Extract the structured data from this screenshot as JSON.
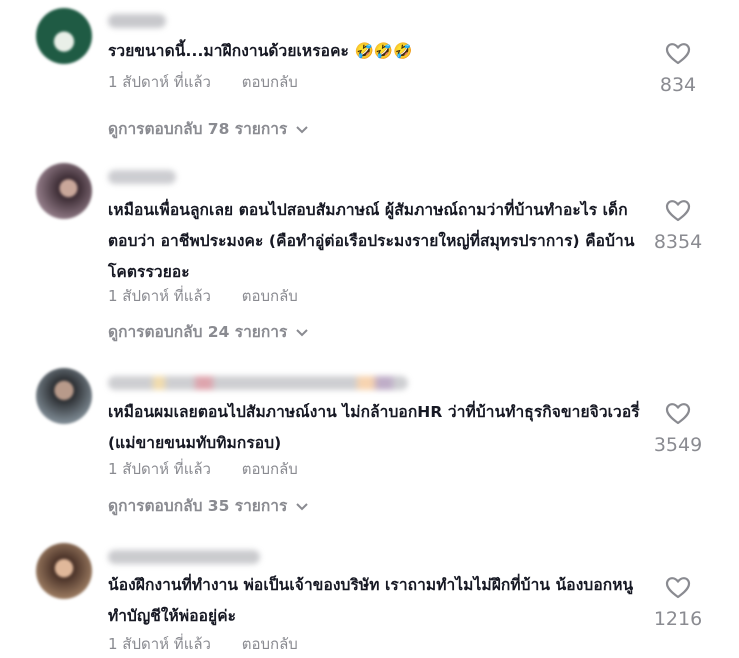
{
  "comments": [
    {
      "text": "รวยขนาดนี้...มาฝึกงานด้วยเหรอคะ 🤣🤣🤣",
      "time": "1 สัปดาห์ ที่แล้ว",
      "reply_label": "ตอบกลับ",
      "likes": "834",
      "view_replies": "ดูการตอบกลับ 78 รายการ",
      "avatar_color": "#1f5b44"
    },
    {
      "text": "เหมือนเพื่อนลูกเลย ตอนไปสอบสัมภาษณ์ ผู้สัมภาษณ์ถามว่าที่บ้านทำอะไร เด็กตอบว่า อาชีพประมงคะ (คือทำอู่ต่อเรือประมงรายใหญ่ที่สมุทรปราการ) คือบ้านโคตรรวยอะ",
      "time": "1 สัปดาห์ ที่แล้ว",
      "reply_label": "ตอบกลับ",
      "likes": "8354",
      "view_replies": "ดูการตอบกลับ 24 รายการ",
      "avatar_color": "#4a3a44"
    },
    {
      "text": "เหมือนผมเลยตอนไปสัมภาษณ์งาน ไม่กล้าบอกHR ว่าที่บ้านทำธุรกิจขายจิวเวอรี่ (แม่ขายขนมทับทิมกรอบ)",
      "time": "1 สัปดาห์ ที่แล้ว",
      "reply_label": "ตอบกลับ",
      "likes": "3549",
      "view_replies": "ดูการตอบกลับ 35 รายการ",
      "avatar_color": "#5c6470"
    },
    {
      "text": "น้องฝึกงานที่ทำงาน พ่อเป็นเจ้าของบริษัท เราถามทำไมไม่ฝึกที่บ้าน น้องบอกหนูทำบัญชีให้พ่ออยู่ค่ะ",
      "time": "1 สัปดาห์ ที่แล้ว",
      "reply_label": "ตอบกลับ",
      "likes": "1216",
      "avatar_color": "#6a4a3a"
    }
  ],
  "icons": {
    "like": "heart-outline-icon",
    "expand": "chevron-down-icon"
  },
  "colors": {
    "text": "#161823",
    "muted": "#8a8b91"
  }
}
